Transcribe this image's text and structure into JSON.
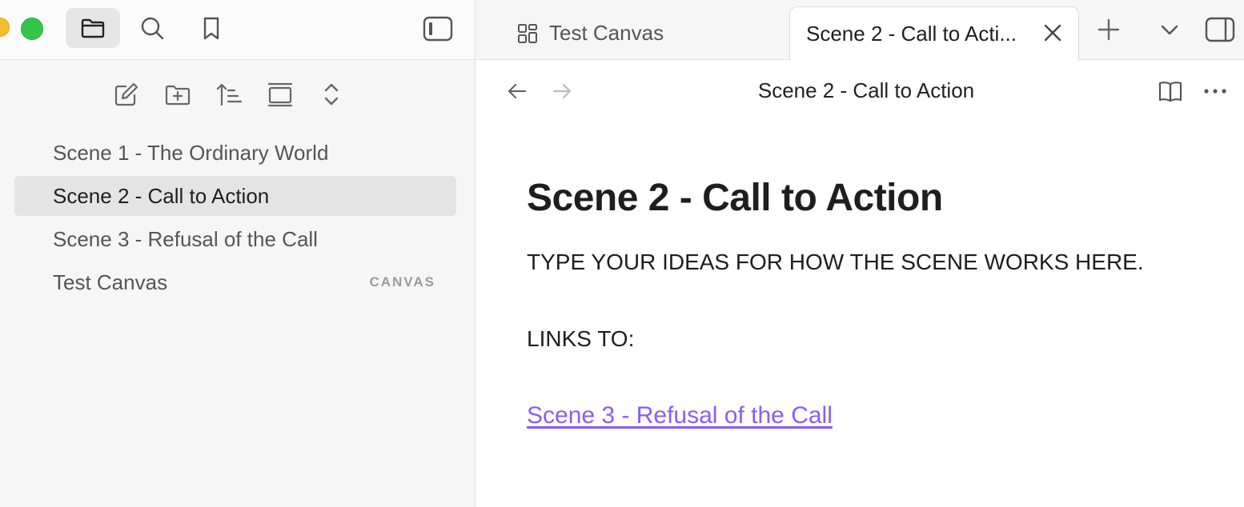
{
  "sidebar": {
    "ribbon": {
      "files_icon": "folder-icon",
      "search_icon": "search-icon",
      "bookmarks_icon": "bookmark-icon"
    },
    "toolbar": [
      "new-note-icon",
      "new-folder-icon",
      "sort-icon",
      "collapse-icon",
      "expand-collapse-icon"
    ],
    "files": [
      {
        "label": "Scene 1 - The Ordinary World",
        "tag": ""
      },
      {
        "label": "Scene 2 - Call to Action",
        "tag": ""
      },
      {
        "label": "Scene 3 - Refusal of the Call",
        "tag": ""
      },
      {
        "label": "Test Canvas",
        "tag": "CANVAS"
      }
    ]
  },
  "tabs": {
    "inactive_label": "Test Canvas",
    "active_label": "Scene 2 - Call to Acti..."
  },
  "view": {
    "title": "Scene 2 - Call to Action"
  },
  "note": {
    "heading": "Scene 2 - Call to Action",
    "paragraph1": "TYPE YOUR IDEAS FOR HOW THE SCENE WORKS HERE.",
    "paragraph2": "LINKS TO:",
    "link": "Scene 3 - Refusal of the Call"
  },
  "colors": {
    "accent_link": "#8a5cf5",
    "traffic_yellow": "#f5bd2e",
    "traffic_green": "#33c748"
  }
}
